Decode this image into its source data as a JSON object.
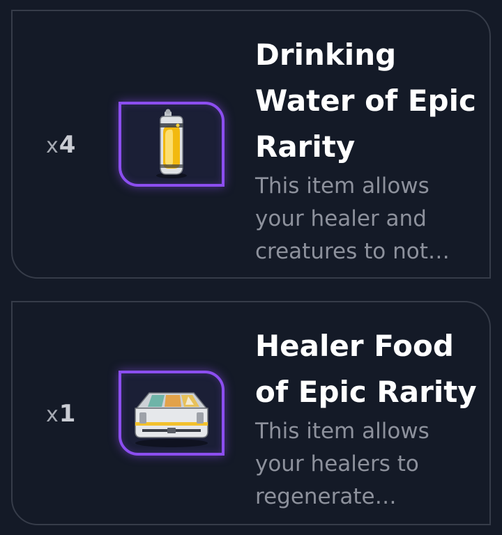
{
  "items": [
    {
      "quantity_prefix": "x",
      "quantity": "4",
      "title": "Drinking Water of Epic Rarity",
      "title_lines": [
        "Drinking",
        "Water of Epic",
        "Rarity"
      ],
      "description_lines": [
        "This item allows",
        "your healer and",
        "creatures to not…"
      ],
      "icon": "water-bottle-icon",
      "rarity_color": "#8c4ef0"
    },
    {
      "quantity_prefix": "x",
      "quantity": "1",
      "title": "Healer Food of Epic Rarity",
      "title_lines": [
        "Healer Food",
        "of Epic Rarity"
      ],
      "description_lines": [
        "This item allows",
        "your healers to",
        "regenerate…"
      ],
      "icon": "food-crate-icon",
      "rarity_color": "#8c4ef0"
    }
  ]
}
